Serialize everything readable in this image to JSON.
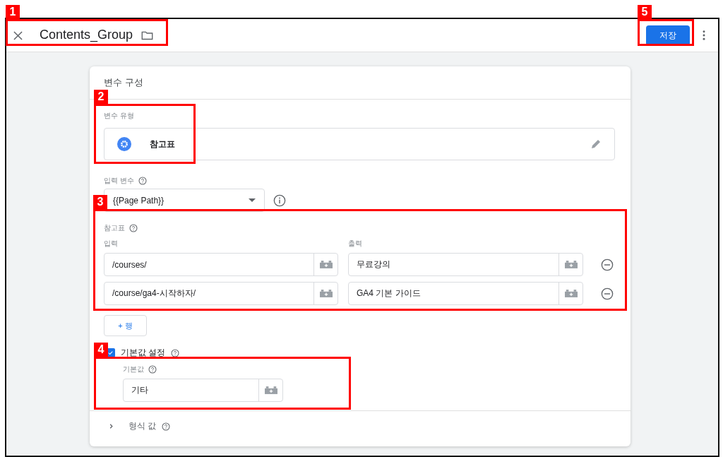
{
  "top_bar": {
    "title": "Contents_Group",
    "save_button": "저장"
  },
  "card": {
    "title": "변수 구성",
    "variable_type": {
      "label": "변수 유형",
      "value": "참고표"
    },
    "input_variable": {
      "label": "입력 변수",
      "value": "{{Page Path}}"
    },
    "lookup_table": {
      "label": "참고표",
      "columns": [
        "입력",
        "출력"
      ],
      "rows": [
        {
          "input": "/courses/",
          "output": "무료강의"
        },
        {
          "input": "/course/ga4-시작하자/",
          "output": "GA4 기본 가이드"
        }
      ],
      "add_row_button": "+ 행"
    },
    "default_value": {
      "label": "기본값 설정",
      "checked": true,
      "field_label": "기본값",
      "value": "기타"
    },
    "format_value": {
      "label": "형식 값",
      "expanded": false
    }
  },
  "annotations": [
    {
      "label": "1"
    },
    {
      "label": "2"
    },
    {
      "label": "3"
    },
    {
      "label": "4"
    },
    {
      "label": "5"
    }
  ]
}
